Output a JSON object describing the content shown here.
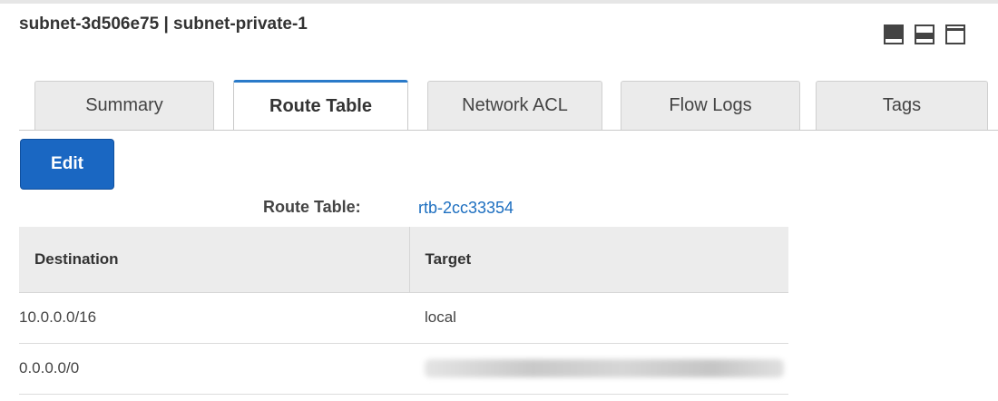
{
  "header": {
    "title": "subnet-3d506e75 | subnet-private-1",
    "layout_icons": [
      "layout-panel-full-icon",
      "layout-panel-split-icon",
      "layout-panel-top-icon"
    ]
  },
  "tabs": [
    {
      "label": "Summary",
      "active": false
    },
    {
      "label": "Route Table",
      "active": true
    },
    {
      "label": "Network ACL",
      "active": false
    },
    {
      "label": "Flow Logs",
      "active": false
    },
    {
      "label": "Tags",
      "active": false
    }
  ],
  "route_table": {
    "edit_label": "Edit",
    "label": "Route Table:",
    "id": "rtb-2cc33354",
    "columns": [
      "Destination",
      "Target"
    ],
    "rows": [
      {
        "destination": "10.0.0.0/16",
        "target": "local"
      },
      {
        "destination": "0.0.0.0/0",
        "target": ""
      }
    ]
  },
  "colors": {
    "accent": "#1a67c2",
    "link": "#1d6fc0"
  }
}
